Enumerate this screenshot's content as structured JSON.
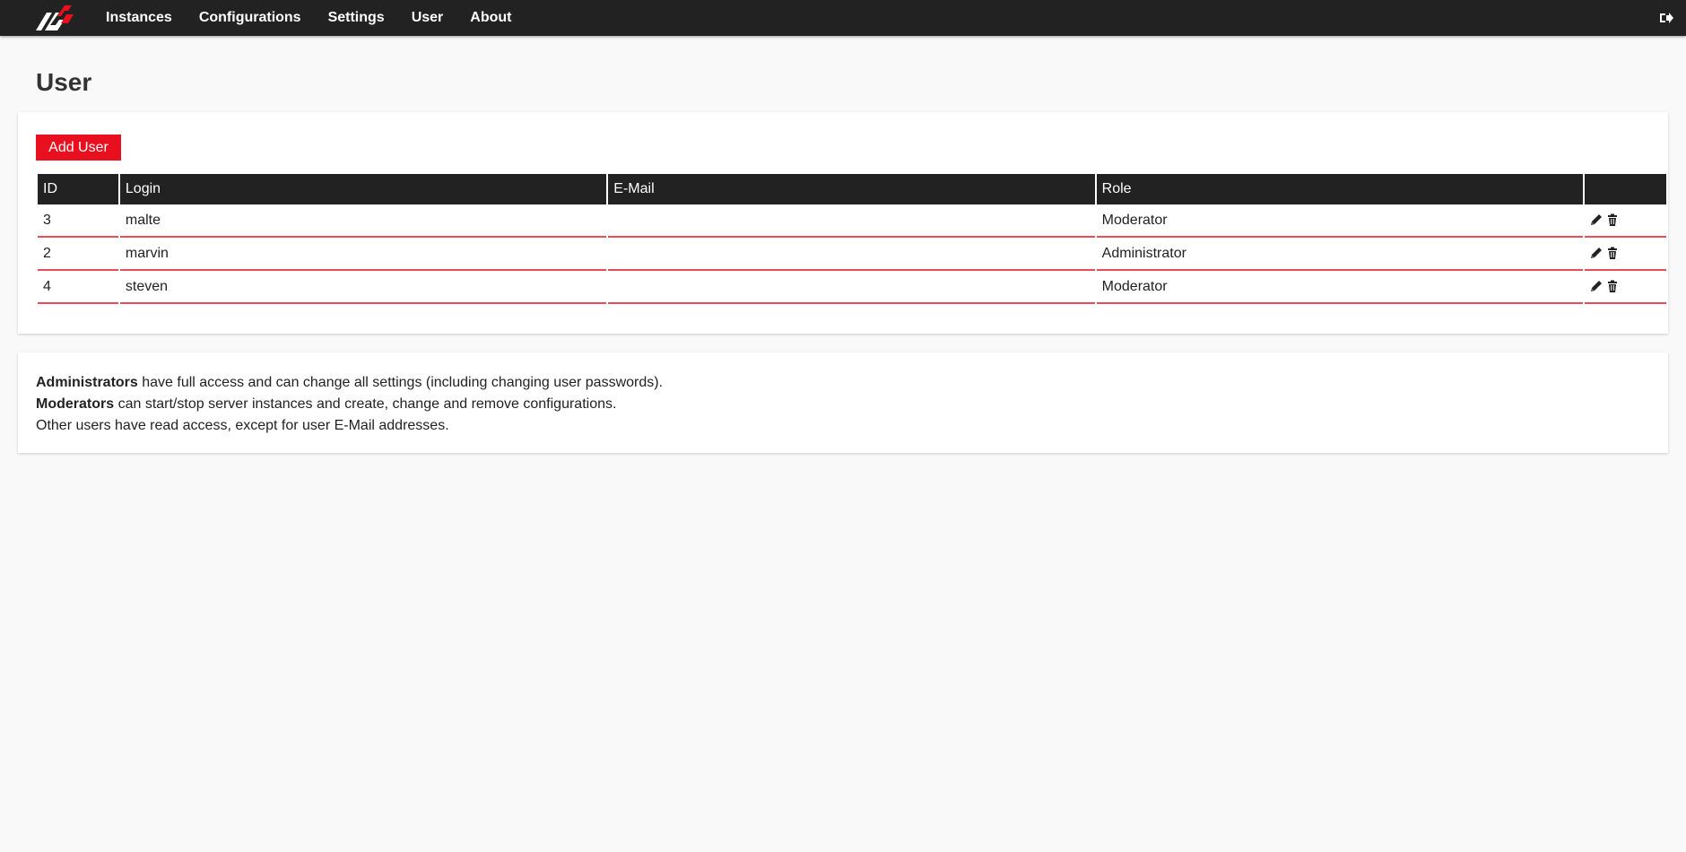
{
  "nav": {
    "items": [
      "Instances",
      "Configurations",
      "Settings",
      "User",
      "About"
    ],
    "logo_icon": "ac-logo",
    "logout_icon": "sign-out-icon"
  },
  "page": {
    "title": "User"
  },
  "users_card": {
    "add_button": "Add User",
    "columns": [
      "ID",
      "Login",
      "E-Mail",
      "Role",
      ""
    ],
    "rows": [
      {
        "id": "3",
        "login": "malte",
        "email": "",
        "role": "Moderator"
      },
      {
        "id": "2",
        "login": "marvin",
        "email": "",
        "role": "Administrator"
      },
      {
        "id": "4",
        "login": "steven",
        "email": "",
        "role": "Moderator"
      }
    ],
    "row_actions": [
      "pencil-icon",
      "trash-icon"
    ]
  },
  "info_card": {
    "line1_bold": "Administrators",
    "line1_rest": " have full access and can change all settings (including changing user passwords).",
    "line2_bold": "Moderators",
    "line2_rest": " can start/stop server instances and create, change and remove configurations.",
    "line3": "Other users have read access, except for user E-Mail addresses."
  },
  "colors": {
    "accent": "#e8101e",
    "topbar": "#222222",
    "row_border": "#e94b57"
  }
}
